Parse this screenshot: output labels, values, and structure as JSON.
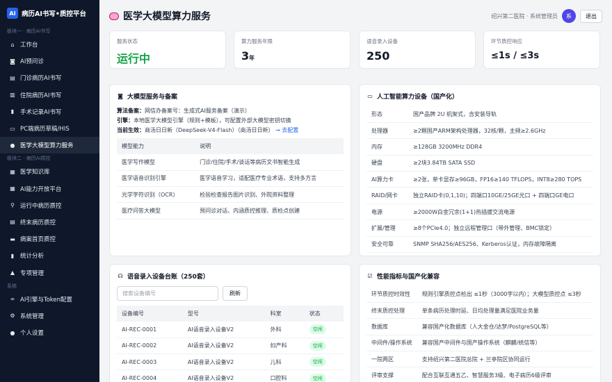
{
  "sidebar": {
    "logo": "AI",
    "brand": "病历AI书写•质控平台",
    "section1": "板块一 · 病历AI书写",
    "section2": "板块二 · 病历AI质控",
    "section3": "系统",
    "items1": [
      {
        "label": "工作台",
        "icon": "home-icon",
        "glyph": "⌂"
      },
      {
        "label": "AI预问诊",
        "icon": "robot-icon",
        "glyph": "◙"
      },
      {
        "label": "门诊病历AI书写",
        "icon": "clipboard-icon",
        "glyph": "▤"
      },
      {
        "label": "住院病历AI书写",
        "icon": "hospital-icon",
        "glyph": "▥"
      },
      {
        "label": "手术记录AI书写",
        "icon": "chart-icon",
        "glyph": "▮"
      },
      {
        "label": "PC端病历草稿/HIS",
        "icon": "monitor-icon",
        "glyph": "▭"
      },
      {
        "label": "医学大模型算力服务",
        "icon": "brain-icon",
        "glyph": "●"
      }
    ],
    "items2": [
      {
        "label": "医学知识库",
        "icon": "books-icon",
        "glyph": "▦"
      },
      {
        "label": "AI能力开放平台",
        "icon": "grid-icon",
        "glyph": "▦"
      },
      {
        "label": "运行中病历质控",
        "icon": "magnifier-icon",
        "glyph": "⚲"
      },
      {
        "label": "终末病历质控",
        "icon": "document-icon",
        "glyph": "▤"
      },
      {
        "label": "病案首页质控",
        "icon": "folder-icon",
        "glyph": "▬"
      },
      {
        "label": "统计分析",
        "icon": "bar-chart-icon",
        "glyph": "▮"
      },
      {
        "label": "专项管理",
        "icon": "warning-icon",
        "glyph": "▲"
      }
    ],
    "items3": [
      {
        "label": "AI引擎与Token配置",
        "icon": "link-icon",
        "glyph": "∞"
      },
      {
        "label": "系统管理",
        "icon": "gear-icon",
        "glyph": "⚙"
      },
      {
        "label": "个人设置",
        "icon": "user-icon",
        "glyph": "●"
      }
    ]
  },
  "header": {
    "title": "医学大模型算力服务",
    "user": "绍兴第二医院 · 系统管理员",
    "avatar": "系",
    "logout": "退出"
  },
  "stats": [
    {
      "label": "服务状态",
      "value": "运行中"
    },
    {
      "label": "算力服务年限",
      "value": "3",
      "unit": "年"
    },
    {
      "label": "语音录入设备",
      "value": "250"
    },
    {
      "label": "环节质控响应",
      "value": "≤1s / ≤3s"
    }
  ],
  "llm": {
    "title": "大模型服务与备案",
    "line1_label": "算法备案：",
    "line1_text": "网信办备案号：生成式AI服务备案（演示）",
    "line2_label": "引擎：",
    "line2_text": "本地医学大模型引擎（规则+模板），可配置外部大模型密钥切换",
    "line3_label": "当前生效：",
    "line3_text": "商汤日日新（DeepSeek-V4-Flash）（商汤日日新）",
    "line3_link": "→ 去配置",
    "columns": [
      "模型能力",
      "说明"
    ],
    "rows": [
      [
        "医学写作模型",
        "门诊/住院/手术/谈话等病历文书智能生成"
      ],
      [
        "医学语音识别引擎",
        "医学语音学习，适配医疗专业术语，支持多方言"
      ],
      [
        "光学字符识别（OCR）",
        "检验检查报告图片识别、外院资料整理"
      ],
      [
        "医疗问答大模型",
        "预问诊对话、内涵质控推理、质检点创建"
      ]
    ]
  },
  "hw": {
    "title": "人工智能算力设备（国产化）",
    "rows": [
      [
        "形态",
        "国产品牌 2U 机架式，含安装导轨"
      ],
      [
        "处理器",
        "≥2颗国产ARM架构处理器，32核/颗，主频≥2.6GHz"
      ],
      [
        "内存",
        "≥128GB 3200MHz DDR4"
      ],
      [
        "硬盘",
        "≥2块3.84TB SATA SSD"
      ],
      [
        "AI算力卡",
        "≥2张，单卡显存≥96GB，FP16≥140 TFLOPS，INT8≥280 TOPS"
      ],
      [
        "RAID/网卡",
        "独立RAID卡(0,1,10)；四端口10GE/25GE光口 + 四端口GE电口"
      ],
      [
        "电源",
        "≥2000W白金冗余(1+1)热插拔交流电源"
      ],
      [
        "扩展/管理",
        "≥8个PCIe4.0；独立远程管理口（带外管理、BMC锁定）"
      ],
      [
        "安全可靠",
        "SNMP SHA256/AES256、Kerberos认证，内存故障隔离"
      ]
    ]
  },
  "voice": {
    "title": "语音录入设备台账（250套）",
    "search_placeholder": "搜索设备编号",
    "refresh": "刷新",
    "columns": [
      "设备编号",
      "型号",
      "科室",
      "状态"
    ],
    "rows": [
      [
        "AI-REC-0001",
        "AI语音录入设备V2",
        "外科",
        "空闲"
      ],
      [
        "AI-REC-0002",
        "AI语音录入设备V2",
        "妇产科",
        "空闲"
      ],
      [
        "AI-REC-0003",
        "AI语音录入设备V2",
        "儿科",
        "空闲"
      ],
      [
        "AI-REC-0004",
        "AI语音录入设备V2",
        "口腔科",
        "空闲"
      ]
    ]
  },
  "perf": {
    "title": "性能指标与国产化兼容",
    "rows": [
      [
        "环节质控时效性",
        "规则引擎质控点检出 ≤1秒（3000字以内）；大模型质控点 ≤3秒"
      ],
      [
        "终末质控处理",
        "单条病历处理时延、日均处理量满足医院业务量"
      ],
      [
        "数据库",
        "兼容国产化数据库（人大金仓/达梦/PostgreSQL等）"
      ],
      [
        "中间件/操作系统",
        "兼容国产中间件与国产操作系统（麒麟/统信等）"
      ],
      [
        "一院两区",
        "支持绍兴第二医院总院 + 兰亭院区协同运行"
      ],
      [
        "评审支撑",
        "配合互联互通五乙、智慧服务3级、电子病历6级评审"
      ]
    ]
  },
  "colors": {
    "sidebar_bg": "#0f172a",
    "accent": "#2563eb",
    "success": "#16a34a",
    "avatar": "#4f46e5"
  }
}
